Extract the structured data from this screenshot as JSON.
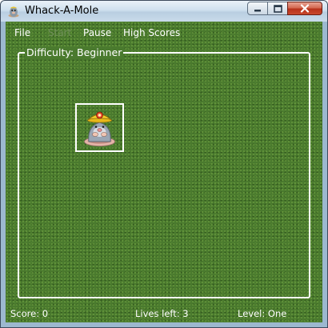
{
  "window": {
    "title": "Whack-A-Mole",
    "icon": "mole-app-icon",
    "controls": {
      "minimize_icon": "minimize-icon",
      "maximize_icon": "maximize-icon",
      "close_icon": "close-icon"
    }
  },
  "menu": {
    "file": "File",
    "start": "Start",
    "pause": "Pause",
    "high_scores": "High Scores"
  },
  "board": {
    "difficulty_label": "Difficulty: Beginner",
    "mole_icon": "mole-icon"
  },
  "status": {
    "score": "Score: 0",
    "lives": "Lives left: 3",
    "level": "Level: One"
  },
  "colors": {
    "grass": "#4a7a2e",
    "text": "#ffffff",
    "disabled_menu": "#6f8f58"
  }
}
